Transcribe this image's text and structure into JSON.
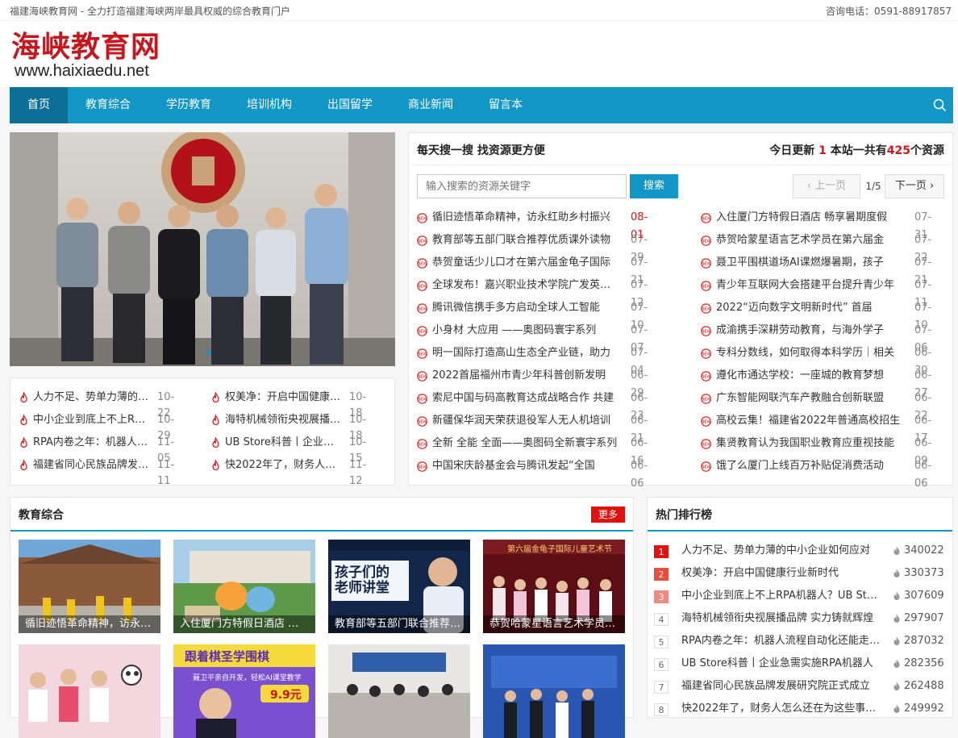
{
  "topbar": {
    "slogan": "福建海峡教育网 - 全力打造福建海峡两岸最具权威的综合教育门户",
    "phone": "咨询电话：0591-88917857"
  },
  "logo": {
    "cn": "海峡教育网",
    "en": "www.haixiaedu.net"
  },
  "nav": [
    {
      "label": "首页",
      "active": true
    },
    {
      "label": "教育综合"
    },
    {
      "label": "学历教育"
    },
    {
      "label": "培训机构"
    },
    {
      "label": "出国留学"
    },
    {
      "label": "商业新闻"
    },
    {
      "label": "留言本"
    }
  ],
  "hot_list": [
    {
      "title": "人力不足、势单力薄的中小企业如何",
      "date": "10-22"
    },
    {
      "title": "权美净：开启中国健康行业新时代",
      "date": "10-18"
    },
    {
      "title": "中小企业到底上不上RPA机器人？",
      "date": "10-29"
    },
    {
      "title": "海特机械领衔央视展播品牌",
      "date": "10-18"
    },
    {
      "title": "RPA内卷之年：机器人流程自动化",
      "date": "11-05"
    },
    {
      "title": "UB Store科普丨企业急需实施RPA",
      "date": "10-15"
    },
    {
      "title": "福建省同心民族品牌发展研究院",
      "date": "11-11"
    },
    {
      "title": "快2022年了，财务人怎么还在为这些",
      "date": "11-12"
    }
  ],
  "search": {
    "title": "每天搜一搜 找资源更方便",
    "stat_prefix": "今日更新",
    "stat_today": "1",
    "stat_mid": "本站一共有",
    "stat_total": "425",
    "stat_suffix": "个资源",
    "placeholder": "输入搜索的资源关键字",
    "button": "搜索",
    "prev": "上一页",
    "page": "1/5",
    "next": "下一页"
  },
  "news": [
    {
      "title": "循旧迹悟革命精神，访永红助乡村振兴",
      "date": "08-01",
      "new": true
    },
    {
      "title": "入住厦门方特假日酒店 畅享暑期度假",
      "date": "07-31"
    },
    {
      "title": "教育部等五部门联合推荐优质课外读物",
      "date": "07-29"
    },
    {
      "title": "恭贺哈蒙星语言艺术学员在第六届金",
      "date": "07-22"
    },
    {
      "title": "恭贺童话少儿口才在第六届金龟子国际",
      "date": "07-21"
    },
    {
      "title": "聂卫平围棋道场AI课燃爆暑期，孩子",
      "date": "07-21"
    },
    {
      "title": "全球发布！嘉兴职业技术学院广发英雄帖",
      "date": "07-12"
    },
    {
      "title": "青少年互联网大会搭建平台提升青少年",
      "date": "07-11"
    },
    {
      "title": "腾讯微信携手多方启动全球人工智能",
      "date": "07-10"
    },
    {
      "title": "2022“迈向数字文明新时代” 首届",
      "date": "07-10"
    },
    {
      "title": "小身材 大应用 ——奥图码寰宇系列",
      "date": "07-07"
    },
    {
      "title": "成渝携手深耕劳动教育，与海外学子",
      "date": "07-06"
    },
    {
      "title": "明一国际打造高山生态全产业链，助力",
      "date": "07-04"
    },
    {
      "title": "专科分数线，如何取得本科学历｜相关",
      "date": "06-30"
    },
    {
      "title": "2022首届福州市青少年科普创新发明",
      "date": "06-29"
    },
    {
      "title": "遵化市通达学校：一座城的教育梦想",
      "date": "06-27"
    },
    {
      "title": "索尼中国与码高教育达成战略合作 共建",
      "date": "06-23"
    },
    {
      "title": "广东智能网联汽车产教融合创新联盟",
      "date": "06-22"
    },
    {
      "title": "新疆保华润天荣获退役军人无人机培训",
      "date": "06-21"
    },
    {
      "title": "高校云集！福建省2022年普通高校招生",
      "date": "06-17"
    },
    {
      "title": "全新 全能 全面——奥图码全新寰宇系列",
      "date": "06-16"
    },
    {
      "title": "集贤教育认为我国职业教育应重视技能",
      "date": "06-09"
    },
    {
      "title": "中国宋庆龄基金会与腾讯发起“全国",
      "date": "06-06"
    },
    {
      "title": "饿了么厦门上线百万补贴促消费活动",
      "date": "06-06"
    }
  ],
  "edu": {
    "title": "教育综合",
    "more": "更多",
    "cards": [
      {
        "caption": "循旧迹悟革命精神，访永红助乡村振兴"
      },
      {
        "caption": "入住厦门方特假日酒店 畅享暑期度假"
      },
      {
        "caption": "教育部等五部门联合推荐优质课外读物"
      },
      {
        "caption": "恭贺哈蒙星语言艺术学员在第六届"
      },
      {
        "caption": "",
        "img": "孩子们的老师讲堂"
      },
      {
        "caption": "",
        "poster": "跟着棋圣学围棋",
        "price": "9.9元"
      },
      {
        "caption": ""
      },
      {
        "caption": ""
      }
    ],
    "card3_banner": "孩子们的\n老师讲堂",
    "card4_banner": "第六届金龟子国际儿童艺术节",
    "card6_head": "跟着棋圣学围棋",
    "card6_sub": "聂卫平亲自开发，轻松AI课堂教学",
    "card6_price": "9.9元"
  },
  "rank": {
    "title": "热门排行榜",
    "items": [
      {
        "n": "1",
        "title": "人力不足、势单力薄的中小企业如何应对",
        "count": "340022"
      },
      {
        "n": "2",
        "title": "权美净：开启中国健康行业新时代",
        "count": "330373"
      },
      {
        "n": "3",
        "title": "中小企业到底上不上RPA机器人？UB Store",
        "count": "307609"
      },
      {
        "n": "4",
        "title": "海特机械领衔央视展播品牌 实力铸就辉煌",
        "count": "297907"
      },
      {
        "n": "5",
        "title": "RPA内卷之年：机器人流程自动化还能走多远",
        "count": "287032"
      },
      {
        "n": "6",
        "title": "UB Store科普丨企业急需实施RPA机器人",
        "count": "282356"
      },
      {
        "n": "7",
        "title": "福建省同心民族品牌发展研究院正式成立",
        "count": "262488"
      },
      {
        "n": "8",
        "title": "快2022年了，财务人怎么还在为这些事发愁",
        "count": "249992"
      }
    ]
  },
  "colors": {
    "accent": "#1296c6",
    "nav_active": "#0d6f95",
    "red": "#e0110e",
    "logo": "#c8161d"
  }
}
